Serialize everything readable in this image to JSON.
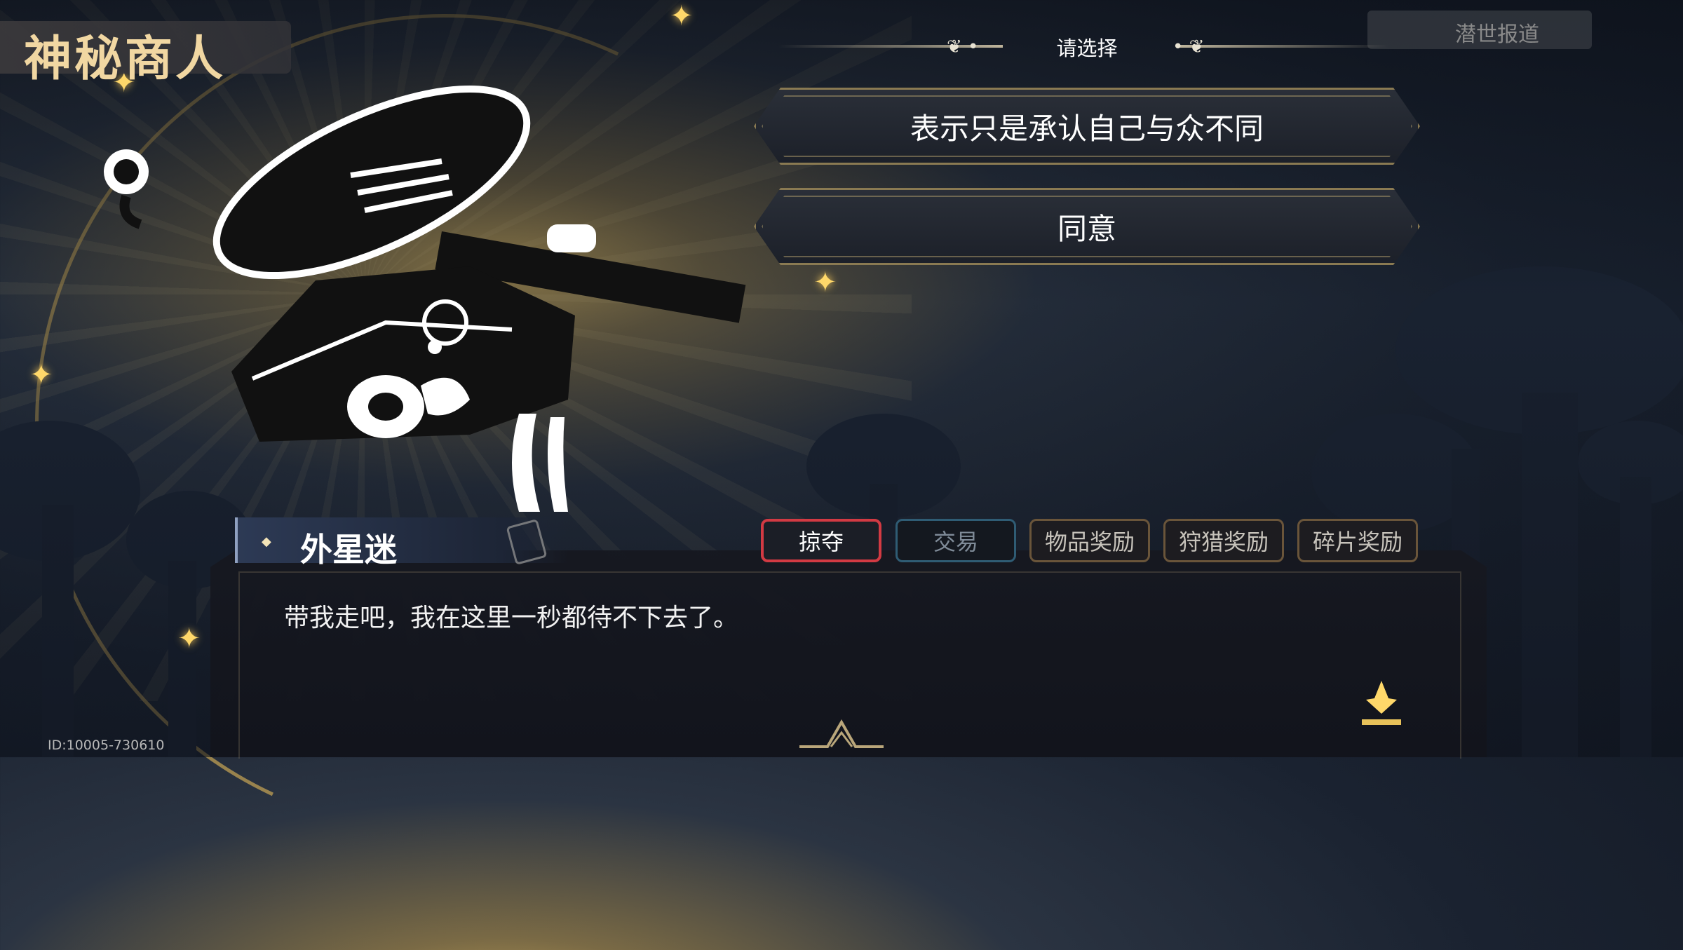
{
  "header": {
    "title": "神秘商人",
    "top_right_label": "潜世报道"
  },
  "prompt": {
    "label": "请选择"
  },
  "choices": [
    {
      "label": "表示只是承认自己与众不同"
    },
    {
      "label": "同意"
    }
  ],
  "speaker": {
    "name": "外星迷"
  },
  "tabs": [
    {
      "label": "掠夺",
      "state": "active"
    },
    {
      "label": "交易",
      "state": "inactive"
    },
    {
      "label": "物品奖励",
      "state": "inactive"
    },
    {
      "label": "狩猎奖励",
      "state": "inactive"
    },
    {
      "label": "碎片奖励",
      "state": "inactive"
    }
  ],
  "dialog": {
    "text": "带我走吧，我在这里一秒都待不下去了。"
  },
  "footer": {
    "id_text": "ID:10005-730610"
  },
  "colors": {
    "accent_gold": "#d6b056",
    "title_text": "#f1d7a2",
    "tab_active_border": "#d23a43",
    "tab_trade_border": "#2f5c74"
  }
}
